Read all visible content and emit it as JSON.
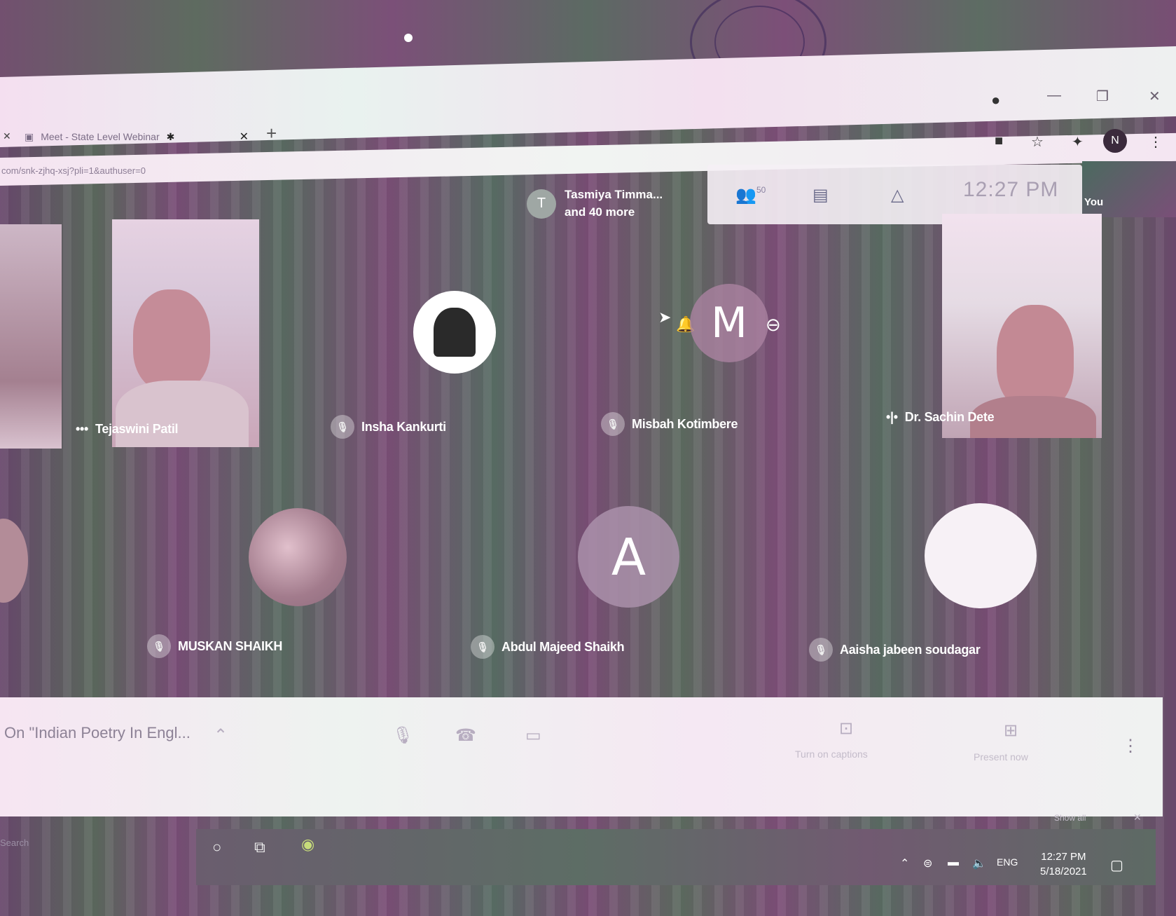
{
  "browser": {
    "tab_title": "Meet - State Level Webinar",
    "url": "com/snk-zjhq-xsj?pli=1&authuser=0",
    "profile_initial": "N"
  },
  "meet": {
    "more_participants": {
      "avatar_initial": "T",
      "line1": "Tasmiya Timma...",
      "line2": "and 40 more"
    },
    "participant_count": "50",
    "clock": "12:27 PM",
    "self_label": "You",
    "meeting_title": "On \"Indian Poetry In Engl...",
    "captions_label": "Turn on captions",
    "present_label": "Present now",
    "show_all": "Show all"
  },
  "participants": [
    {
      "name": "Tejaswini Patil",
      "type": "video"
    },
    {
      "name": "Insha Kankurti",
      "type": "avatar-image"
    },
    {
      "name": "Misbah Kotimbere",
      "type": "initial",
      "initial": "M"
    },
    {
      "name": "Dr. Sachin Dete",
      "type": "video"
    },
    {
      "name": "MUSKAN SHAIKH",
      "type": "avatar-image"
    },
    {
      "name": "Abdul Majeed Shaikh",
      "type": "initial",
      "initial": "A"
    },
    {
      "name": "Aaisha jabeen soudagar",
      "type": "avatar-image"
    }
  ],
  "taskbar": {
    "search": "Search",
    "time": "12:27 PM",
    "date": "5/18/2021",
    "lang": "ENG"
  },
  "colors": {
    "meet_bg": "#6e5a70",
    "panel_bg": "#f5eff5"
  }
}
